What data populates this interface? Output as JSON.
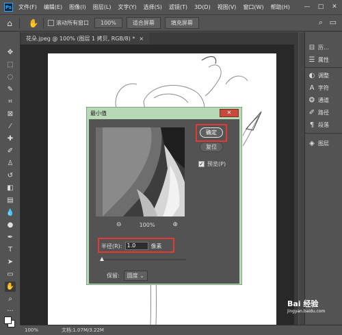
{
  "menu": {
    "items": [
      "文件(F)",
      "编辑(E)",
      "图像(I)",
      "图层(L)",
      "文字(Y)",
      "选择(S)",
      "滤镜(T)",
      "3D(D)",
      "视图(V)",
      "窗口(W)",
      "帮助(H)"
    ],
    "logo": "Ps"
  },
  "options": {
    "scroll_all_label": "滚动所有窗口",
    "zoom_value": "100%",
    "fit_screen_label": "适合屏幕",
    "fill_screen_label": "填充屏幕"
  },
  "document": {
    "tab_title": "花朵.jpeg @ 100% (图层 1 拷贝, RGB/8) *",
    "close_glyph": "×"
  },
  "panel": {
    "history": "历...",
    "properties": "属性",
    "adjustments": "调整",
    "character": "字符",
    "channels": "通道",
    "paths": "路径",
    "paragraph": "段落",
    "layers": "图层"
  },
  "status": {
    "zoom": "100%",
    "doc_info": "文档:1.07M/3.22M"
  },
  "dialog": {
    "title": "最小值",
    "close_glyph": "✕",
    "ok_label": "确定",
    "reset_label": "复位",
    "preview_label": "预览(P)",
    "preview_checked": true,
    "zoom_value": "100%",
    "radius_label": "半径(R):",
    "radius_value": "1.0",
    "radius_unit": "像素",
    "keep_label": "保留:",
    "keep_value": "圆度"
  },
  "watermark": {
    "text": "Bai 经验",
    "sub": "jingyan.baidu.com"
  },
  "colors": {
    "ui_bg": "#535353",
    "canvas_bg": "#282828",
    "dialog_frame": "#b7d9b5",
    "highlight": "#e53935"
  }
}
